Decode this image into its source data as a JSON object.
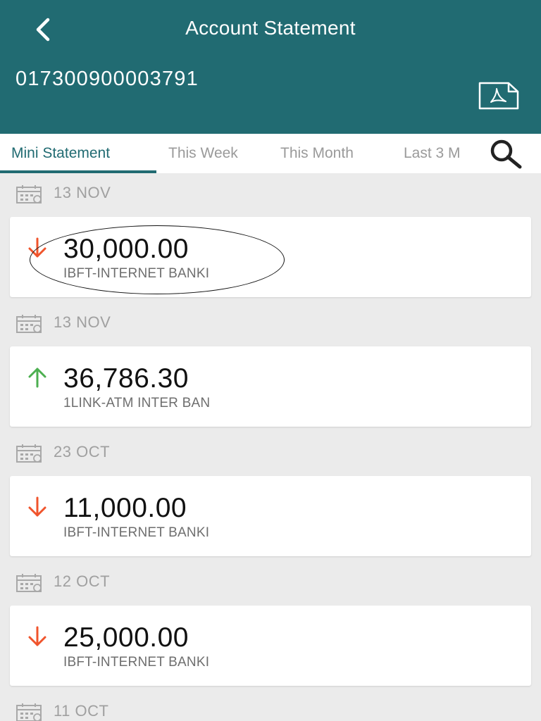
{
  "header": {
    "title": "Account Statement",
    "account_number": "017300900003791"
  },
  "tabs": [
    {
      "label": "Mini Statement",
      "active": true
    },
    {
      "label": "This Week",
      "active": false
    },
    {
      "label": "This Month",
      "active": false
    },
    {
      "label": "Last 3 M",
      "active": false
    }
  ],
  "transactions": [
    {
      "date": "13 NOV",
      "amount": "30,000.00",
      "description": "IBFT-INTERNET BANKI",
      "direction": "debit"
    },
    {
      "date": "13 NOV",
      "amount": "36,786.30",
      "description": "1LINK-ATM INTER BAN",
      "direction": "credit"
    },
    {
      "date": "23 OCT",
      "amount": "11,000.00",
      "description": "IBFT-INTERNET BANKI",
      "direction": "debit"
    },
    {
      "date": "12 OCT",
      "amount": "25,000.00",
      "description": "IBFT-INTERNET BANKI",
      "direction": "debit"
    }
  ],
  "next_date": "11 OCT",
  "colors": {
    "primary": "#216b72",
    "debit": "#f0542c",
    "credit": "#4caf50"
  },
  "icons": [
    "back-arrow-icon",
    "pdf-icon",
    "search-icon",
    "calendar-icon",
    "arrow-down-icon",
    "arrow-up-icon"
  ]
}
